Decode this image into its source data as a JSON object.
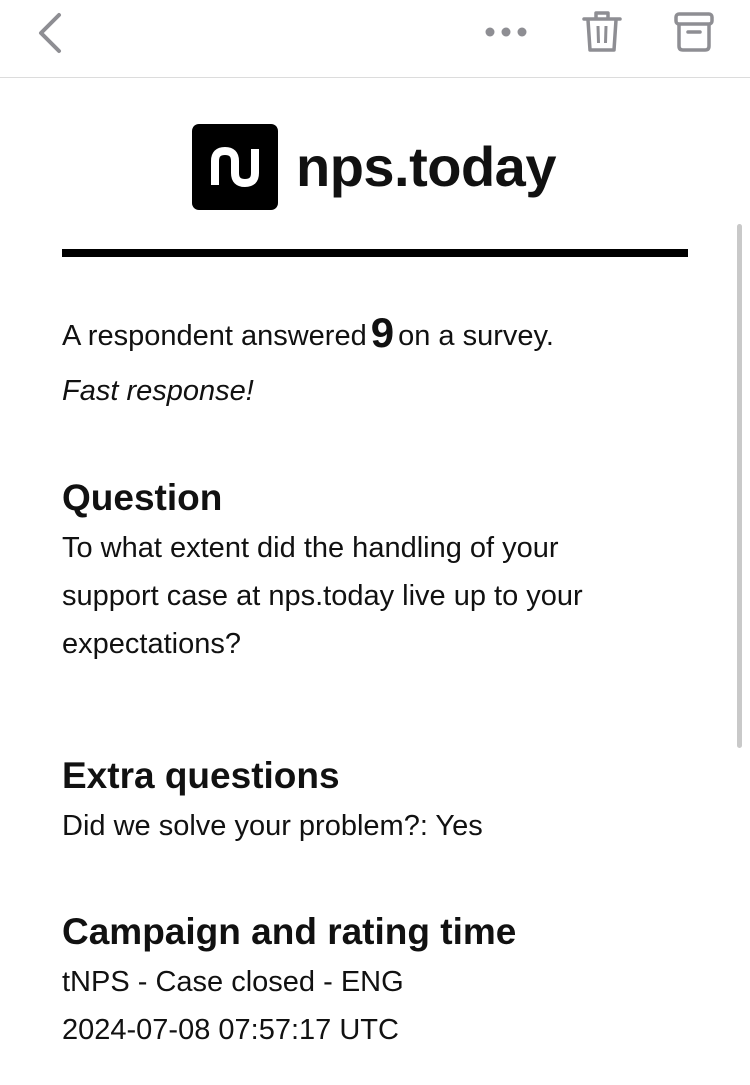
{
  "toolbar": {
    "back_icon": "chevron-left-icon",
    "more_icon": "ellipsis-icon",
    "trash_icon": "trash-icon",
    "archive_icon": "archive-icon"
  },
  "email": {
    "logo_text": "nps.today",
    "answer_prefix": "A respondent answered",
    "score": "9",
    "answer_suffix": "on a survey.",
    "note": "Fast response!",
    "question_heading": "Question",
    "question_text": "To what extent did the handling of your support case at nps.today live up to your expectations?",
    "extra_heading": "Extra questions",
    "extra_text": "Did we solve your problem?: Yes",
    "campaign_heading": "Campaign and rating time",
    "campaign_name": "tNPS - Case closed - ENG",
    "rating_time": "2024-07-08 07:57:17 UTC"
  }
}
